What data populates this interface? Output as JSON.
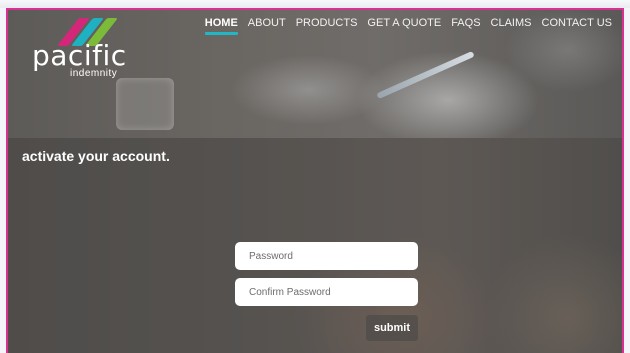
{
  "brand": {
    "name": "pacific",
    "tagline": "indemnity",
    "stripe_colors": [
      "#d4277a",
      "#1fb1c1",
      "#7cbb3a"
    ]
  },
  "nav": {
    "items": [
      {
        "label": "HOME",
        "active": true
      },
      {
        "label": "ABOUT",
        "active": false
      },
      {
        "label": "PRODUCTS",
        "active": false
      },
      {
        "label": "GET A QUOTE",
        "active": false
      },
      {
        "label": "FAQS",
        "active": false
      },
      {
        "label": "CLAIMS",
        "active": false
      },
      {
        "label": "CONTACT US",
        "active": false
      }
    ]
  },
  "form": {
    "heading": "activate your account.",
    "password_placeholder": "Password",
    "confirm_placeholder": "Confirm Password",
    "submit_label": "submit"
  },
  "colors": {
    "frame_border": "#d8318f",
    "nav_active_underline": "#22b7c6"
  }
}
